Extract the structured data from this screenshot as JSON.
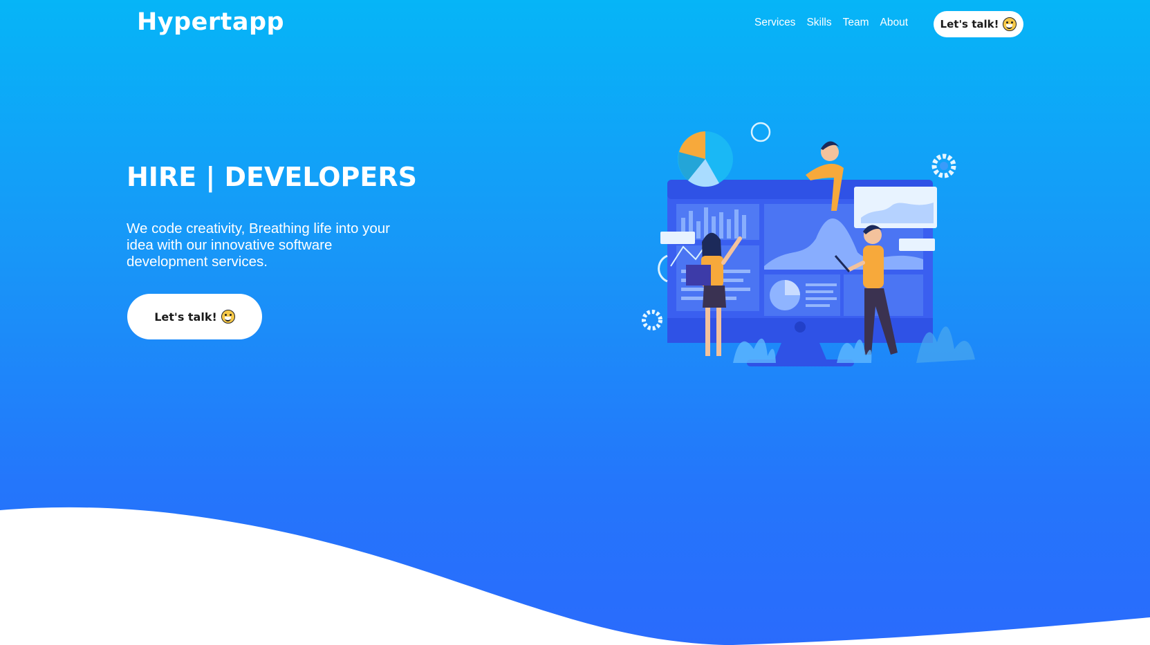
{
  "brand": {
    "name": "Hypertapp"
  },
  "nav": {
    "items": [
      {
        "label": "Services"
      },
      {
        "label": "Skills"
      },
      {
        "label": "Team"
      },
      {
        "label": "About"
      }
    ],
    "cta_label": "Let's talk!",
    "cta_icon": "grinning-face-icon"
  },
  "hero": {
    "headline": "HIRE | DEVELOPERS",
    "subtext": "We code creativity, Breathing life into your idea with our innovative software development services.",
    "cta_label": "Let's talk!",
    "cta_icon": "grinning-face-icon"
  },
  "colors": {
    "gradient_top": "#06b5f7",
    "gradient_bottom": "#2a6bfc",
    "button_bg": "#ffffff",
    "accent_orange": "#f7a93b"
  }
}
